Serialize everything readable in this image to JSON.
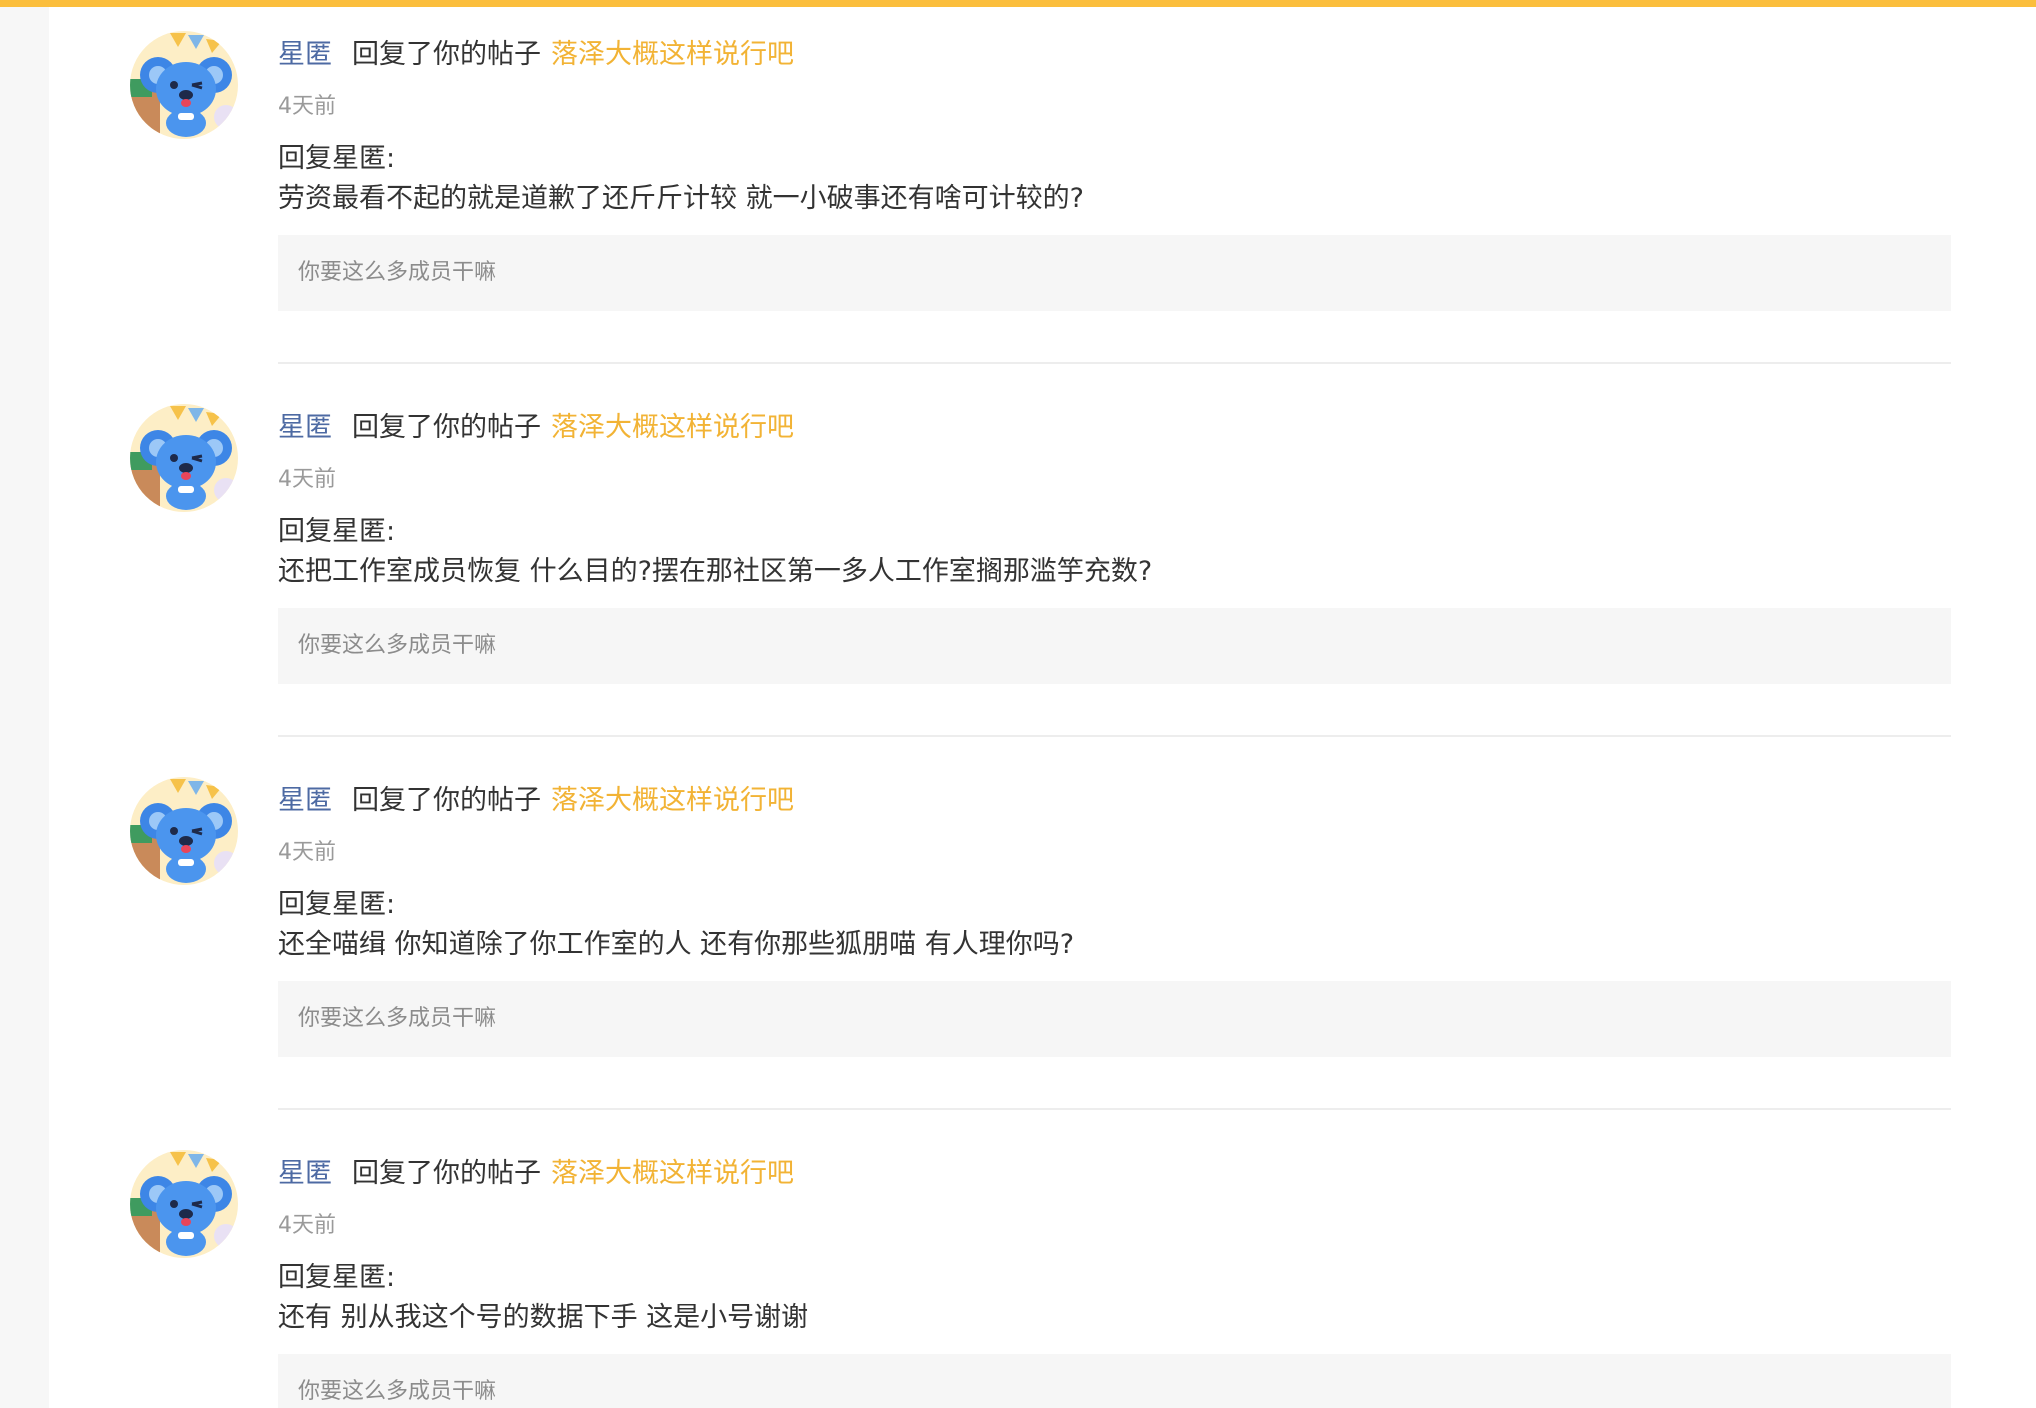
{
  "notifications": [
    {
      "username": "星匿",
      "action": "回复了你的帖子",
      "post_title": "落泽大概这样说行吧",
      "time": "4天前",
      "reply_prefix": "回复星匿:",
      "reply_text": "劳资最看不起的就是道歉了还斤斤计较 就一小破事还有啥可计较的?",
      "quote": "你要这么多成员干嘛"
    },
    {
      "username": "星匿",
      "action": "回复了你的帖子",
      "post_title": "落泽大概这样说行吧",
      "time": "4天前",
      "reply_prefix": "回复星匿:",
      "reply_text": "还把工作室成员恢复 什么目的?摆在那社区第一多人工作室搁那滥竽充数?",
      "quote": "你要这么多成员干嘛"
    },
    {
      "username": "星匿",
      "action": "回复了你的帖子",
      "post_title": "落泽大概这样说行吧",
      "time": "4天前",
      "reply_prefix": "回复星匿:",
      "reply_text": "还全喵缉 你知道除了你工作室的人 还有你那些狐朋喵 有人理你吗?",
      "quote": "你要这么多成员干嘛"
    },
    {
      "username": "星匿",
      "action": "回复了你的帖子",
      "post_title": "落泽大概这样说行吧",
      "time": "4天前",
      "reply_prefix": "回复星匿:",
      "reply_text": "还有 别从我这个号的数据下手 这是小号谢谢",
      "quote": "你要这么多成员干嘛"
    }
  ],
  "colors": {
    "accent_bar": "#fbbe3c",
    "username": "#4d6aa3",
    "post_title": "#f2b335",
    "text": "#333333",
    "muted": "#9a9a9a"
  }
}
